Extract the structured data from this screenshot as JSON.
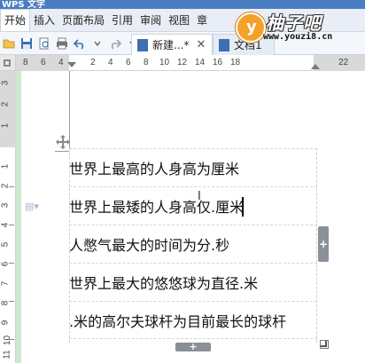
{
  "window": {
    "title": "WPS 文字"
  },
  "menu": {
    "items": [
      "开始",
      "插入",
      "页面布局",
      "引用",
      "审阅",
      "视图",
      "章"
    ]
  },
  "logo": {
    "brand": "柚子吧",
    "url": "www.youzi8.cn"
  },
  "toolbar": {
    "icons": [
      "folder-icon",
      "save-icon",
      "print-preview-icon",
      "print-icon",
      "undo-icon",
      "redo-icon"
    ]
  },
  "tabs": [
    {
      "label": "新建...*",
      "active": true
    },
    {
      "label": "文档1",
      "active": false
    }
  ],
  "ruler": {
    "h_labels": [
      "8",
      "6",
      "4",
      "2",
      "2",
      "4",
      "6",
      "8",
      "10",
      "12",
      "14",
      "16",
      "18",
      "22"
    ],
    "v_labels": [
      "3",
      "2",
      "1",
      "1",
      "2",
      "3",
      "4",
      "5",
      "6",
      "7",
      "8",
      "9",
      "10",
      "11"
    ]
  },
  "table": {
    "rows": [
      "世界上最高的人身高为厘米",
      "世界上最矮的人身高仅.厘米",
      "人憋气最大的时间为分.秒",
      "世界上最大的悠悠球为直径.米",
      ".米的高尔夫球杆为目前最长的球杆"
    ]
  },
  "colors": {
    "accent": "#4a7cc1",
    "add_button": "#8a8f98"
  }
}
